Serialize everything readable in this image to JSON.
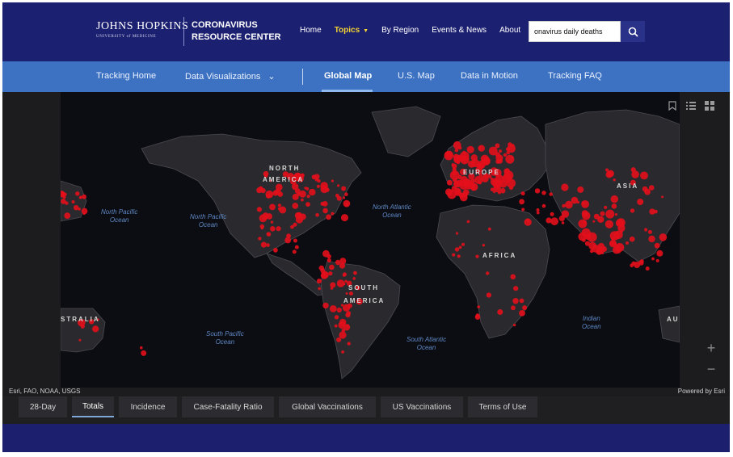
{
  "header": {
    "logo_line1": "JOHNS HOPKINS",
    "logo_line2": "UNIVERSITY of MEDICINE",
    "brand_line1": "CORONAVIRUS",
    "brand_line2": "RESOURCE CENTER",
    "nav": [
      {
        "label": "Home"
      },
      {
        "label": "Topics",
        "caret": "▼"
      },
      {
        "label": "By Region"
      },
      {
        "label": "Events & News"
      },
      {
        "label": "About"
      }
    ],
    "search_value": "onavirus daily deaths"
  },
  "subnav": {
    "items": [
      "Tracking Home",
      "Data Visualizations",
      "Global Map",
      "U.S. Map",
      "Data in Motion",
      "Tracking FAQ"
    ],
    "dropdown_chevron": "⌄"
  },
  "map": {
    "continents": [
      "NORTH",
      "AMERICA",
      "EUROPE",
      "ASIA",
      "AFRICA",
      "SOUTH",
      "AMERICA",
      "STRALIA",
      "AU"
    ],
    "oceans": [
      {
        "line1": "North Pacific",
        "line2": "Ocean"
      },
      {
        "line1": "North Pacific",
        "line2": "Ocean"
      },
      {
        "line1": "North Atlantic",
        "line2": "Ocean"
      },
      {
        "line1": "South Pacific",
        "line2": "Ocean"
      },
      {
        "line1": "South Atlantic",
        "line2": "Ocean"
      },
      {
        "line1": "Indian",
        "line2": "Ocean"
      }
    ],
    "attribution_left": "Esri, FAO, NOAA, USGS",
    "attribution_right": "Powered by Esri",
    "zoom_in": "+",
    "zoom_out": "−",
    "tool_icons": [
      "bookmark-icon",
      "list-icon",
      "grid-icon"
    ],
    "marker_color": "#e3101c"
  },
  "tabs": [
    "28-Day",
    "Totals",
    "Incidence",
    "Case-Fatality Ratio",
    "Global Vaccinations",
    "US Vaccinations",
    "Terms of Use"
  ]
}
